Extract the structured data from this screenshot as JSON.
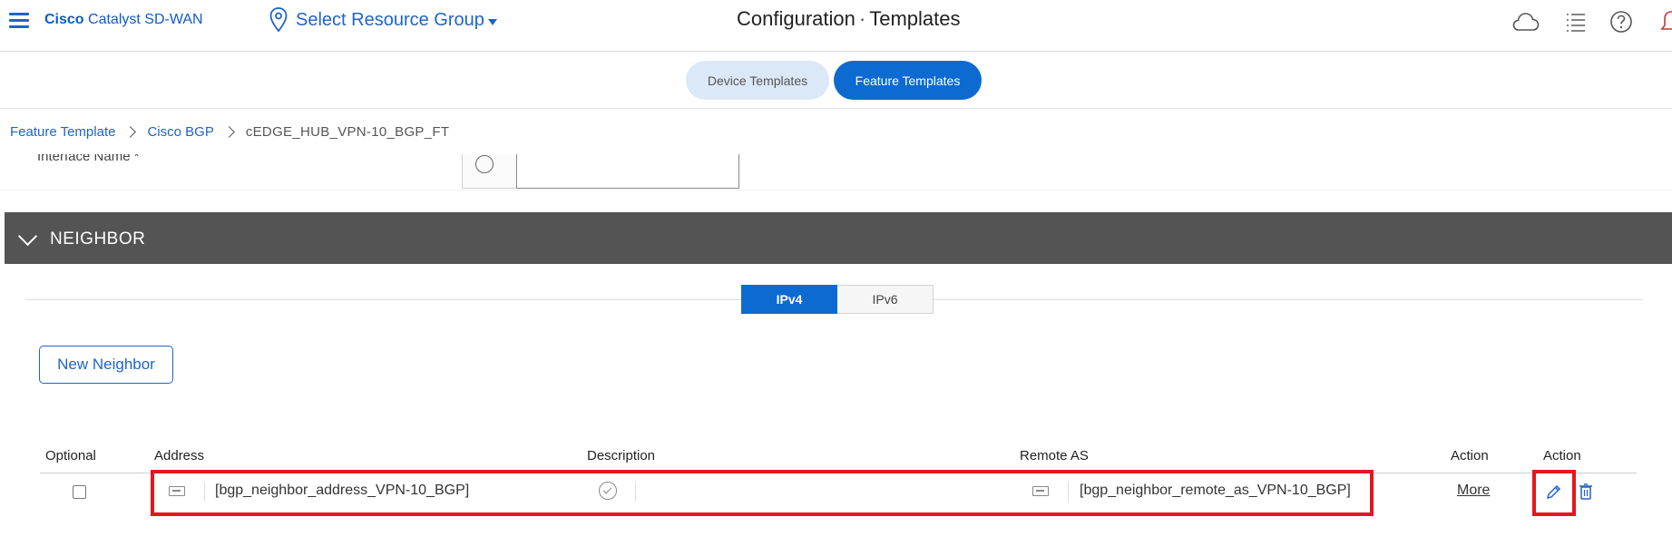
{
  "header": {
    "brand_bold": "Cisco",
    "brand_rest": " Catalyst SD-WAN",
    "resource_group": "Select Resource Group",
    "title_section": "Configuration",
    "title_separator": "·",
    "title_page": "Templates",
    "icons": [
      "menu-icon",
      "location-pin-icon",
      "cloud-icon",
      "tasks-list-icon",
      "help-icon",
      "bell-icon"
    ]
  },
  "tabs": {
    "device": "Device Templates",
    "feature": "Feature Templates",
    "active": "feature"
  },
  "breadcrumb": {
    "items": [
      "Feature Template",
      "Cisco BGP"
    ],
    "current": "cEDGE_HUB_VPN-10_BGP_FT"
  },
  "clipped_section": {
    "label": "Interface Name *"
  },
  "neighbor_section": {
    "title": "NEIGHBOR",
    "ip_tabs": [
      "IPv4",
      "IPv6"
    ],
    "ip_active": "IPv4",
    "new_button": "New Neighbor",
    "table": {
      "columns": [
        "Optional",
        "Address",
        "Description",
        "Remote AS",
        "Action",
        "Action"
      ],
      "rows": [
        {
          "optional_checked": false,
          "address": "[bgp_neighbor_address_VPN-10_BGP]",
          "description": "",
          "remote_as": "[bgp_neighbor_remote_as_VPN-10_BGP]",
          "action_link": "More",
          "action_icons": [
            "edit-icon",
            "trash-icon"
          ]
        }
      ]
    }
  },
  "colors": {
    "primary_blue": "#0d6ad1",
    "section_bar": "#545454",
    "highlight_red": "#e3171e"
  }
}
